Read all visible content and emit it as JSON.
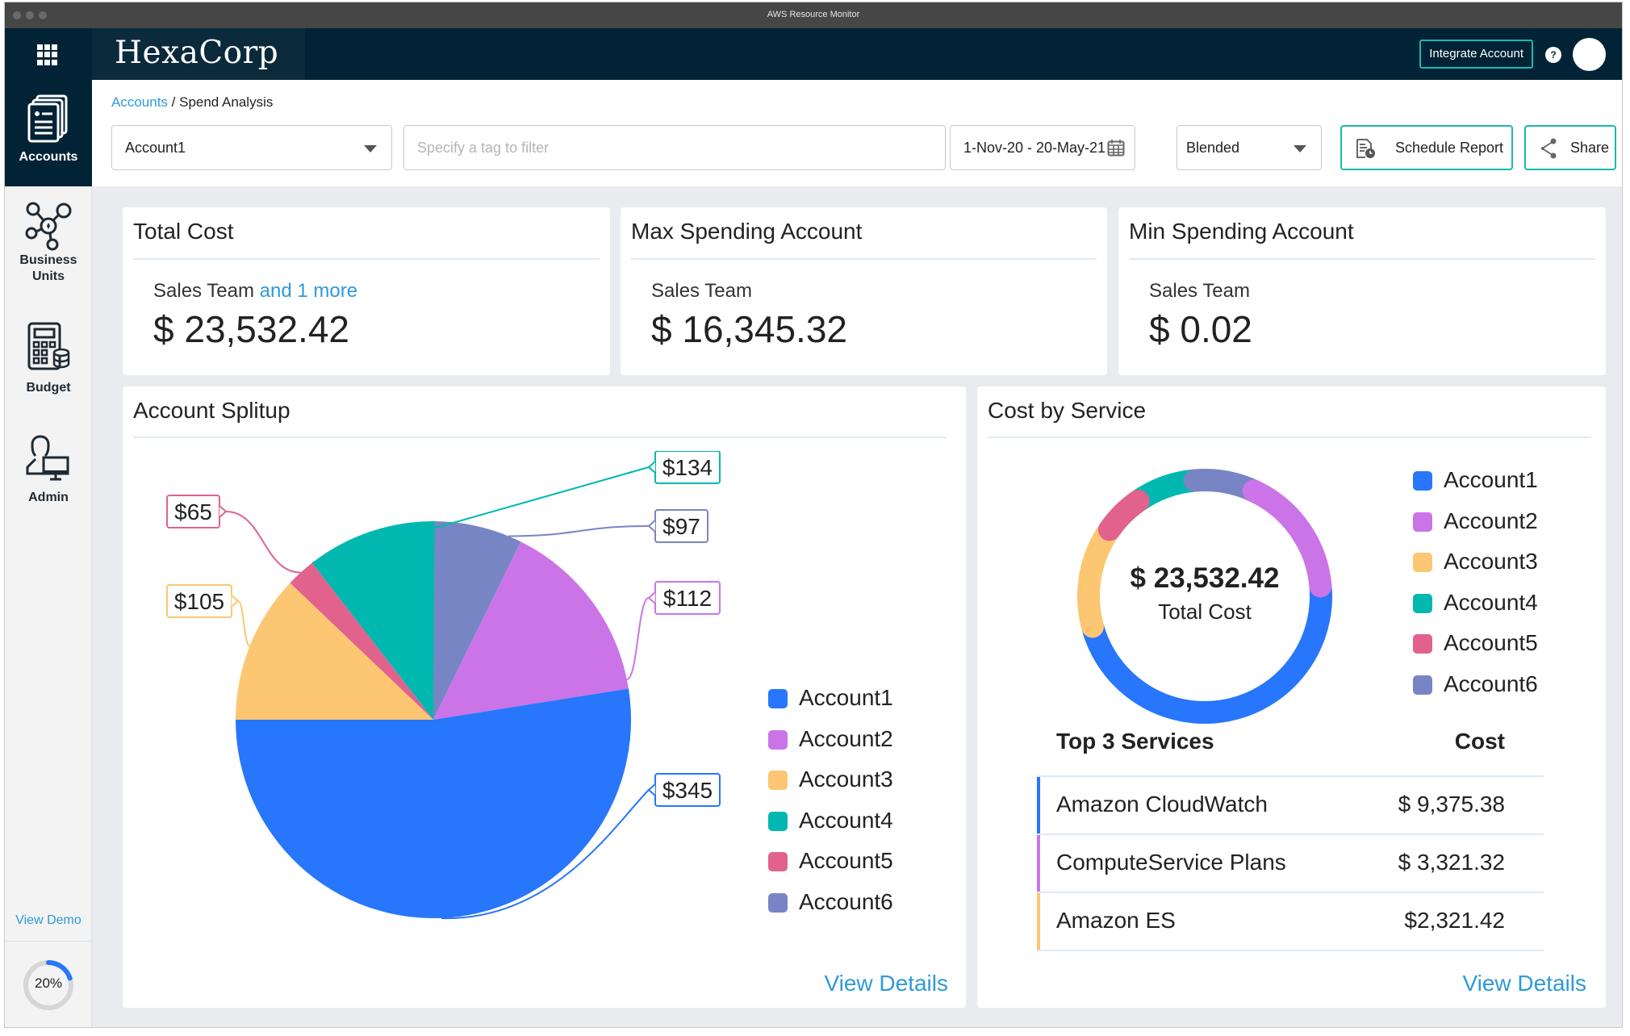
{
  "window": {
    "title": "AWS Resource Monitor"
  },
  "topnav": {
    "logo": "HexaCorp",
    "integrate_label": "Integrate Account",
    "help_label": "?"
  },
  "sidebar": {
    "items": [
      {
        "label": "Accounts",
        "icon": "accounts-icon",
        "active": true
      },
      {
        "label": "Business Units",
        "icon": "business-units-icon",
        "active": false
      },
      {
        "label": "Budget",
        "icon": "budget-icon",
        "active": false
      },
      {
        "label": "Admin",
        "icon": "admin-icon",
        "active": false
      }
    ],
    "view_demo": "View Demo",
    "progress": {
      "value": 0.2,
      "label": "20%"
    }
  },
  "breadcrumb": {
    "parent": "Accounts",
    "separator": " / ",
    "current": "Spend Analysis"
  },
  "filters": {
    "account_select": "Account1",
    "tag_placeholder": "Specify a tag to filter",
    "date_range": "1-Nov-20 - 20-May-21",
    "cost_type": "Blended",
    "schedule_label": "Schedule Report",
    "share_label": "Share"
  },
  "summary": [
    {
      "title": "Total Cost",
      "sub": "Sales Team",
      "more": "and 1 more",
      "value": "$ 23,532.42"
    },
    {
      "title": "Max Spending Account",
      "sub": "Sales Team",
      "more": "",
      "value": "$ 16,345.32"
    },
    {
      "title": "Min Spending Account",
      "sub": "Sales Team",
      "more": "",
      "value": "$ 0.02"
    }
  ],
  "colors": {
    "accent": "#17b9b0",
    "link": "#2e9ad9",
    "nav_dark": "#022335",
    "Account1": "#2776fc",
    "Account2": "#cb74e8",
    "Account3": "#fdc672",
    "Account4": "#00b8b0",
    "Account5": "#e1628c",
    "Account6": "#7885c4"
  },
  "account_splitup": {
    "title": "Account Splitup",
    "view_details": "View Details"
  },
  "cost_by_service": {
    "title": "Cost by Service",
    "center_value": "$ 23,532.42",
    "center_label": "Total Cost",
    "legend": [
      "Account1",
      "Account2",
      "Account3",
      "Account4",
      "Account5",
      "Account6"
    ],
    "table_header": {
      "service": "Top 3 Services",
      "cost": "Cost"
    },
    "services": [
      {
        "name": "Amazon CloudWatch",
        "cost": "$ 9,375.38",
        "color": "#2776fc"
      },
      {
        "name": "ComputeService Plans",
        "cost": "$ 3,321.32",
        "color": "#cb74e8"
      },
      {
        "name": "Amazon ES",
        "cost": "$2,321.42",
        "color": "#fdc672"
      }
    ],
    "view_details": "View Details"
  },
  "chart_data": [
    {
      "type": "pie",
      "title": "Account Splitup",
      "legend_position": "right",
      "categories": [
        "Account1",
        "Account2",
        "Account3",
        "Account4",
        "Account5",
        "Account6"
      ],
      "values": [
        345,
        112,
        105,
        134,
        65,
        97
      ],
      "value_labels": [
        "$345",
        "$112",
        "$105",
        "$134",
        "$65",
        "$97"
      ],
      "visual_share_pct": [
        52.5,
        15.2,
        12.1,
        10.6,
        2.4,
        7.3
      ],
      "draw_order_clockwise_from_top": [
        "Account6",
        "Account2",
        "Account1",
        "Account3",
        "Account5",
        "Account4"
      ]
    },
    {
      "type": "pie",
      "subtype": "donut",
      "title": "Cost by Service",
      "legend_position": "right",
      "categories": [
        "Account1",
        "Account2",
        "Account3",
        "Account4",
        "Account5",
        "Account6"
      ],
      "visual_share_pct": [
        47.2,
        16.7,
        13.9,
        8.3,
        5.6,
        8.3
      ],
      "draw_order_clockwise_from_top": [
        "Account6",
        "Account2",
        "Account1",
        "Account3",
        "Account5",
        "Account4"
      ],
      "center_text": "$ 23,532.42",
      "center_subtext": "Total Cost"
    }
  ]
}
